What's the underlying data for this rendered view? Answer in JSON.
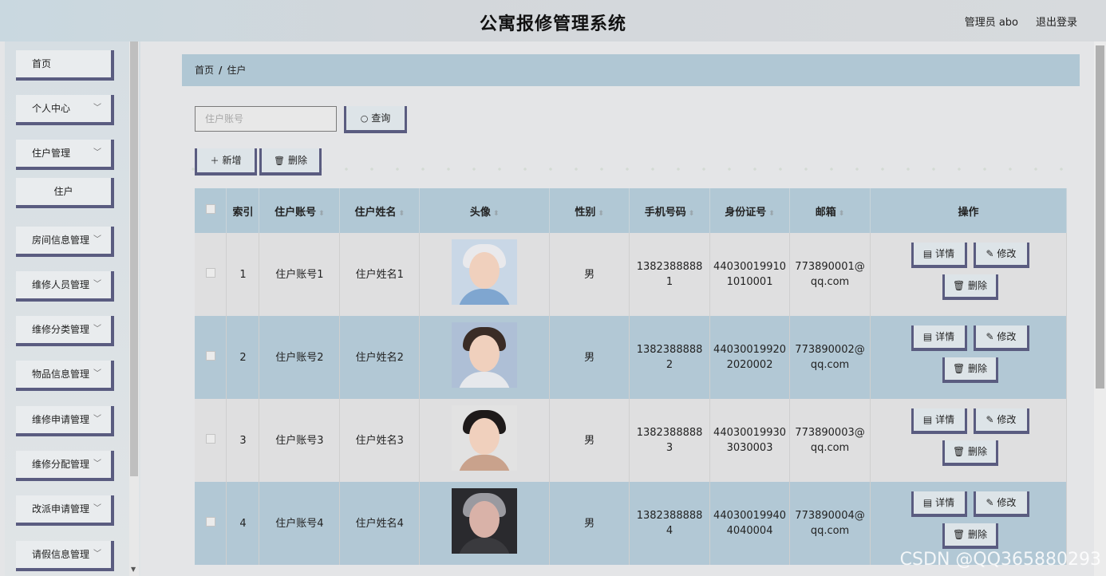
{
  "header": {
    "title": "公寓报修管理系统",
    "user": "管理员 abo",
    "logout": "退出登录"
  },
  "sidebar": {
    "items": [
      {
        "label": "首页",
        "chevron": false
      },
      {
        "label": "个人中心",
        "chevron": true
      },
      {
        "label": "住户管理",
        "chevron": true
      },
      {
        "label": "住户",
        "chevron": false,
        "sub": true
      },
      {
        "label": "房间信息管理",
        "chevron": true
      },
      {
        "label": "维修人员管理",
        "chevron": true
      },
      {
        "label": "维修分类管理",
        "chevron": true
      },
      {
        "label": "物品信息管理",
        "chevron": true
      },
      {
        "label": "维修申请管理",
        "chevron": true
      },
      {
        "label": "维修分配管理",
        "chevron": true
      },
      {
        "label": "改派申请管理",
        "chevron": true
      },
      {
        "label": "请假信息管理",
        "chevron": true
      }
    ]
  },
  "breadcrumb": {
    "home": "首页",
    "sep": "/",
    "current": "住户"
  },
  "search": {
    "placeholder": "住户账号",
    "button": "查询"
  },
  "toolbar": {
    "add": "新增",
    "delete": "删除"
  },
  "table": {
    "headers": {
      "index": "索引",
      "account": "住户账号",
      "name": "住户姓名",
      "avatar": "头像",
      "gender": "性别",
      "phone": "手机号码",
      "id_card": "身份证号",
      "email": "邮箱",
      "actions": "操作"
    },
    "rows": [
      {
        "index": "1",
        "account": "住户账号1",
        "name": "住户姓名1",
        "gender": "男",
        "phone_a": "1382388888",
        "phone_b": "1",
        "id_a": "44030019910",
        "id_b": "1010001",
        "email_a": "773890001@",
        "email_b": "qq.com"
      },
      {
        "index": "2",
        "account": "住户账号2",
        "name": "住户姓名2",
        "gender": "男",
        "phone_a": "1382388888",
        "phone_b": "2",
        "id_a": "44030019920",
        "id_b": "2020002",
        "email_a": "773890002@",
        "email_b": "qq.com"
      },
      {
        "index": "3",
        "account": "住户账号3",
        "name": "住户姓名3",
        "gender": "男",
        "phone_a": "1382388888",
        "phone_b": "3",
        "id_a": "44030019930",
        "id_b": "3030003",
        "email_a": "773890003@",
        "email_b": "qq.com"
      },
      {
        "index": "4",
        "account": "住户账号4",
        "name": "住户姓名4",
        "gender": "男",
        "phone_a": "1382388888",
        "phone_b": "4",
        "id_a": "44030019940",
        "id_b": "4040004",
        "email_a": "773890004@",
        "email_b": "qq.com"
      }
    ],
    "row_actions": {
      "detail": "详情",
      "edit": "修改",
      "delete": "删除"
    }
  },
  "watermark": "CSDN @QQ365880293"
}
